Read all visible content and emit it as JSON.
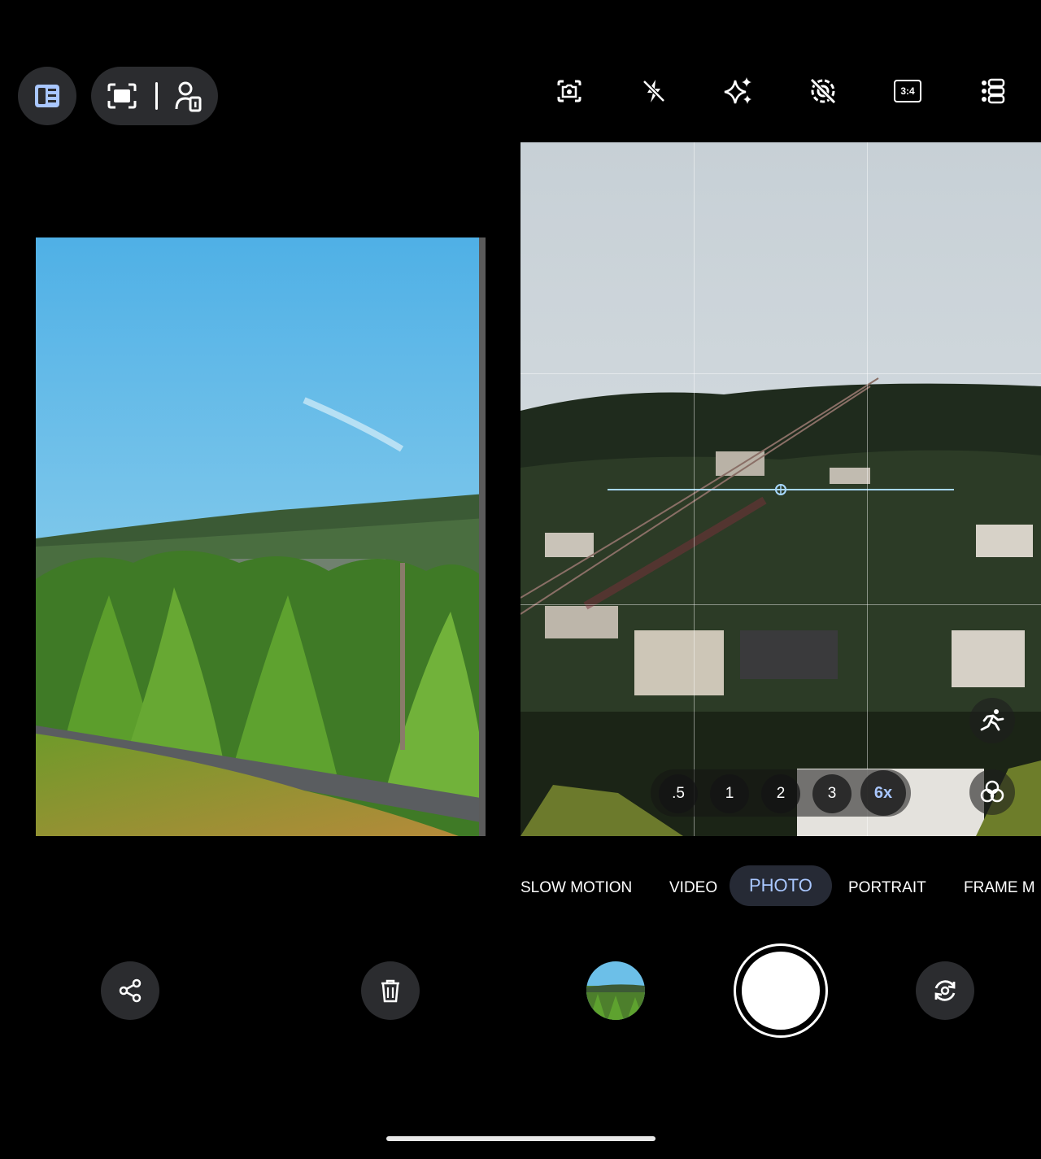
{
  "top_left": {
    "panel_icon": "side-panel-icon",
    "fullscreen_icon": "fullscreen-frame-icon",
    "person_device_icon": "person-device-icon"
  },
  "top_right_icons": [
    "camera-settings-icon",
    "flash-off-icon",
    "enhance-sparkle-icon",
    "motion-photo-off-icon",
    "aspect-ratio-icon",
    "more-settings-icon"
  ],
  "aspect_ratio_label": "3:4",
  "zoom": {
    "levels": [
      ".5",
      "1",
      "2",
      "3",
      "6x"
    ],
    "active": "6x"
  },
  "modes": [
    "SLOW MOTION",
    "VIDEO",
    "PHOTO",
    "PORTRAIT",
    "FRAME M"
  ],
  "active_mode": "PHOTO",
  "bottom": {
    "share_icon": "share-icon",
    "delete_icon": "trash-icon",
    "switch_camera_icon": "switch-camera-icon"
  },
  "colors": {
    "accent": "#a9c7ff",
    "button_bg": "#2b2c2f"
  }
}
